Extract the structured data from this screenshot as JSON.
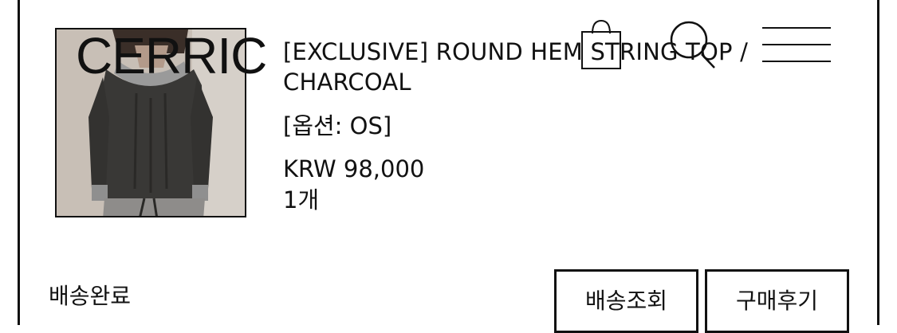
{
  "header": {
    "logo_text": "CERRIC",
    "icons": [
      "shopping-bag-icon",
      "search-icon",
      "menu-icon"
    ]
  },
  "order_item": {
    "image_alt": "round hem string top charcoal product photo",
    "title": "[EXCLUSIVE] ROUND HEM STRING TOP / CHARCOAL",
    "option": "[옵션: OS]",
    "price": "KRW 98,000",
    "quantity": "1개"
  },
  "order_status": {
    "label": "배송완료"
  },
  "actions": {
    "track_label": "배송조회",
    "review_label": "구매후기"
  },
  "colors": {
    "text": "#111111",
    "background": "#ffffff",
    "border": "#111111"
  }
}
